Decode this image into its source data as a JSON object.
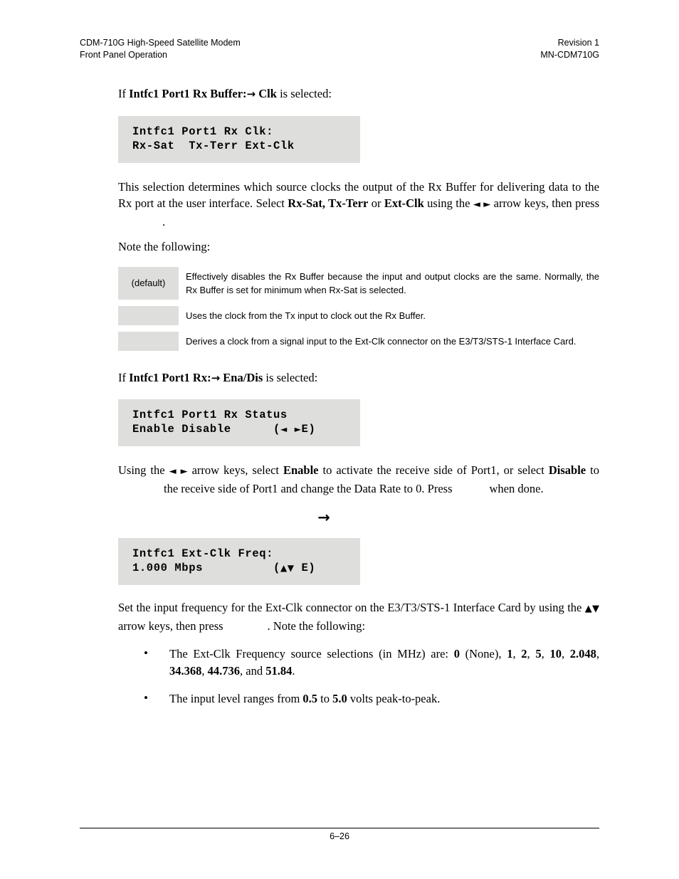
{
  "header": {
    "left_line1": "CDM-710G High-Speed Satellite Modem",
    "left_line2": "Front Panel Operation",
    "right_line1": "Revision 1",
    "right_line2": "MN-CDM710G"
  },
  "sections": {
    "intro1": {
      "prefix": "If ",
      "bold1": "Intfc1 Port1 Rx Buffer:",
      "arrow": "→",
      "bold2": "Clk",
      "suffix": " is selected:"
    },
    "lcd1": {
      "line1": "Intfc1 Port1 Rx Clk:",
      "line2": "Rx-Sat  Tx-Terr Ext-Clk"
    },
    "para1": {
      "part1": "This selection determines which source clocks the output of the Rx Buffer for delivering data to the Rx port at the user interface. Select ",
      "bold1": "Rx-Sat, Tx-Terr",
      "mid1": " or ",
      "bold2": "Ext-Clk",
      "mid2": " using the ",
      "arrows": "◄ ►",
      "mid3": " arrow keys, then press",
      "end": "."
    },
    "note_intro": "Note the following:",
    "note_table": {
      "rows": [
        {
          "key": "(default)",
          "desc": "Effectively disables the Rx Buffer because the input and output clocks are the same. Normally, the Rx Buffer is set for minimum when Rx-Sat is selected."
        },
        {
          "key": "",
          "desc": "Uses the clock from the Tx input to clock out the Rx Buffer."
        },
        {
          "key": "",
          "desc": "Derives a clock from a signal input to the Ext-Clk connector on the E3/T3/STS-1 Interface Card."
        }
      ]
    },
    "intro2": {
      "prefix": "If ",
      "bold1": "Intfc1 Port1 Rx:",
      "arrow": "→",
      "bold2": "Ena/Dis",
      "suffix": " is selected:"
    },
    "lcd2": {
      "line1": "Intfc1 Port1 Rx Status",
      "line2_left": "Enable Disable",
      "line2_right_open": "(",
      "line2_left_arrow": "◄",
      "line2_right_arrow": "►",
      "line2_e": "E)"
    },
    "para2": {
      "part1": "Using the ",
      "arrows": "◄ ►",
      "part2": " arrow keys, select ",
      "bold1": "Enable",
      "part3": " to activate the receive side of Port1, or select ",
      "bold2": "Disable",
      "part4": " to",
      "part5": "the receive side of Port1 and change the Data Rate to 0. Press",
      "part6": "when done."
    },
    "lone_arrow": "→",
    "lcd3": {
      "line1": "Intfc1 Ext-Clk Freq:",
      "line2_left": "1.000 Mbps",
      "line2_open": "(",
      "line2_up": "▲",
      "line2_down": "▼",
      "line2_e": "E)"
    },
    "para3": {
      "part1": "Set the input frequency for the Ext-Clk connector on the E3/T3/STS-1 Interface Card by using the ",
      "arrows": "▲▼",
      "part2": " arrow keys, then press",
      "part3": ". Note the following:"
    },
    "bullets": [
      {
        "dot": "•",
        "part1": "The Ext-Clk Frequency source selections (in MHz) are: ",
        "b1": "0",
        "t1": " (None), ",
        "b2": "1",
        "t2": ", ",
        "b3": "2",
        "t3": ", ",
        "b4": "5",
        "t4": ", ",
        "b5": "10",
        "t5": ", ",
        "b6": "2.048",
        "t6": ", ",
        "b7": "34.368",
        "t7": ", ",
        "b8": "44.736",
        "t8": ", and ",
        "b9": "51.84",
        "t9": "."
      },
      {
        "dot": "•",
        "part1": "The input level ranges from ",
        "b1": "0.5",
        "t1": " to ",
        "b2": "5.0",
        "t2": " volts peak-to-peak."
      }
    ]
  },
  "footer": {
    "page_number": "6–26"
  }
}
